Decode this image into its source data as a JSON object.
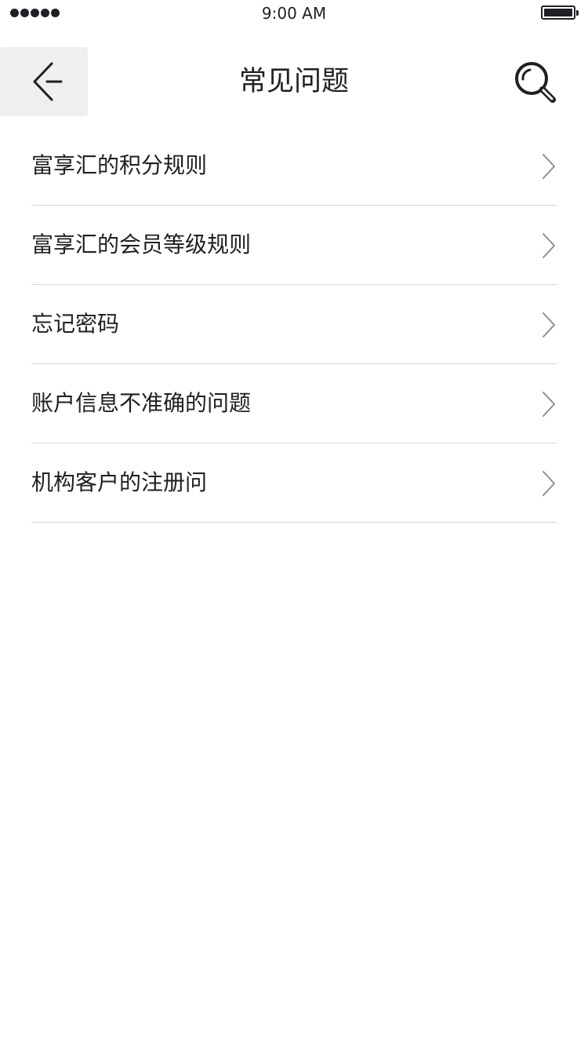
{
  "status_bar": {
    "time": "9:00 AM",
    "signal_dots": 5,
    "battery_level": 1.0
  },
  "header": {
    "title": "常见问题",
    "back_icon": "back-arrow-icon",
    "search_icon": "search-icon"
  },
  "faq": {
    "items": [
      {
        "label": "富享汇的积分规则"
      },
      {
        "label": "富享汇的会员等级规则"
      },
      {
        "label": "忘记密码"
      },
      {
        "label": "账户信息不准确的问题"
      },
      {
        "label": "机构客户的注册问"
      }
    ],
    "chevron_icon": "chevron-right-icon"
  },
  "colors": {
    "text": "#1f1f24",
    "back_button_bg": "#efeff0",
    "divider": "#d8d8d8",
    "chevron": "#8e8e93",
    "background": "#ffffff"
  }
}
